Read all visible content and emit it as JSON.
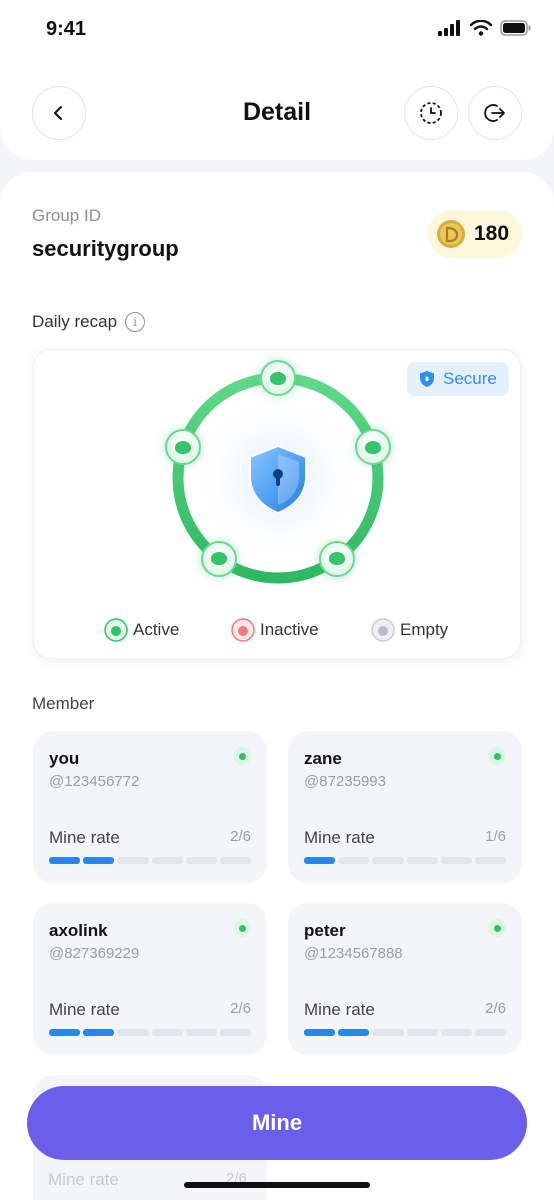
{
  "status_bar": {
    "time": "9:41"
  },
  "header": {
    "title": "Detail"
  },
  "group": {
    "label": "Group ID",
    "name": "securitygroup",
    "coins": "180"
  },
  "recap": {
    "label": "Daily recap",
    "secure_label": "Secure",
    "legend": {
      "active": "Active",
      "inactive": "Inactive",
      "empty": "Empty"
    },
    "colors": {
      "active": "#2fc266",
      "inactive": "#f07a7a",
      "empty": "#b9bcc4",
      "shield": "#2d8ff0"
    }
  },
  "members": {
    "label": "Member",
    "items": [
      {
        "name": "you",
        "handle": "@123456772",
        "rate_label": "Mine rate",
        "rate": "2/6",
        "filled": 2,
        "total": 6
      },
      {
        "name": "zane",
        "handle": "@87235993",
        "rate_label": "Mine rate",
        "rate": "1/6",
        "filled": 1,
        "total": 6
      },
      {
        "name": "axolink",
        "handle": "@827369229",
        "rate_label": "Mine rate",
        "rate": "2/6",
        "filled": 2,
        "total": 6
      },
      {
        "name": "peter",
        "handle": "@1234567888",
        "rate_label": "Mine rate",
        "rate": "2/6",
        "filled": 2,
        "total": 6
      }
    ],
    "partial": {
      "rate_label": "Mine rate",
      "rate": "2/6"
    }
  },
  "actions": {
    "mine_label": "Mine"
  },
  "theme": {
    "primary": "#6a5eeb",
    "progress": "#2a86ec",
    "coin_bg": "#fdf7dd"
  }
}
